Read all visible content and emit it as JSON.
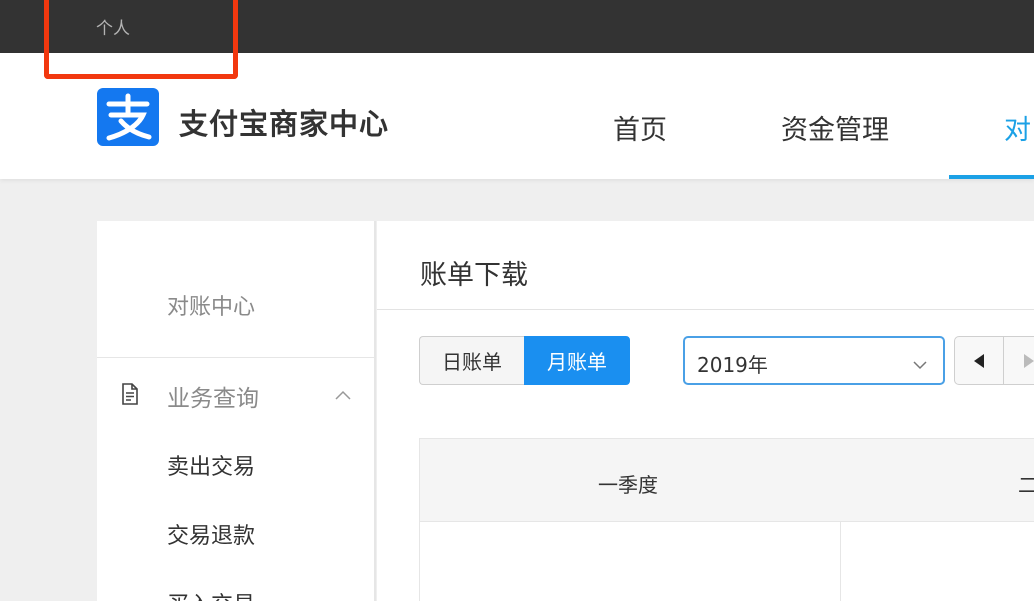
{
  "topbar": {
    "personal_label": "个人"
  },
  "header": {
    "brand_name": "支付宝商家中心",
    "nav": [
      {
        "label": "首页"
      },
      {
        "label": "资金管理"
      },
      {
        "label": "对"
      }
    ]
  },
  "sidebar": {
    "title": "对账中心",
    "group_label": "业务查询",
    "items": [
      {
        "label": "卖出交易"
      },
      {
        "label": "交易退款"
      },
      {
        "label": "买入交易"
      }
    ]
  },
  "main": {
    "title": "账单下载",
    "toggle": {
      "day_label": "日账单",
      "month_label": "月账单",
      "selected": "month"
    },
    "year_select": {
      "value": "2019年"
    },
    "table": {
      "columns": [
        "一季度",
        "二"
      ]
    }
  },
  "colors": {
    "topbar_bg": "#333333",
    "accent_blue": "#1a8ff0",
    "nav_active": "#1ba1e6",
    "highlight_red": "#f2380f",
    "logo_blue": "#1478f0"
  }
}
